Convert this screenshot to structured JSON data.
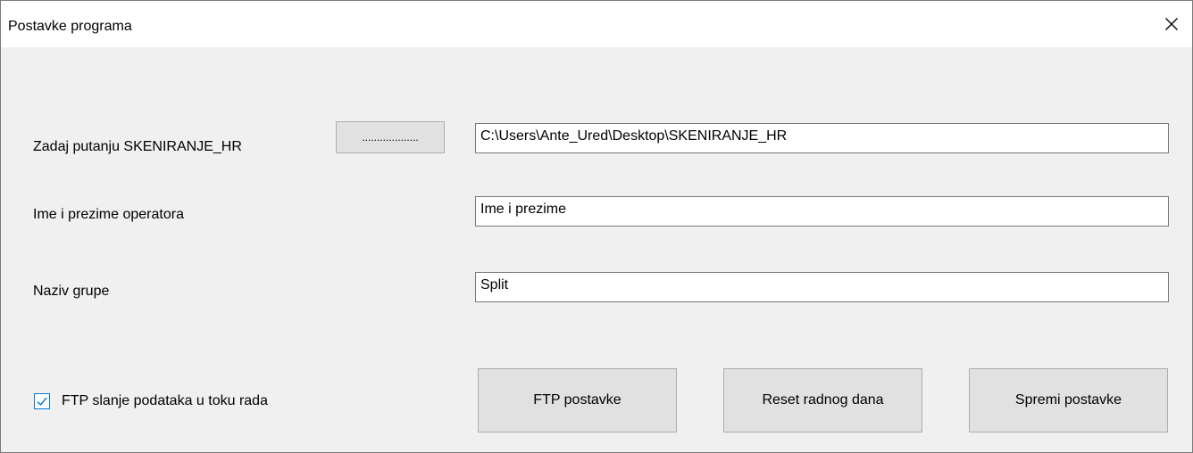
{
  "window": {
    "title": "Postavke programa"
  },
  "path": {
    "label": "Zadaj putanju  SKENIRANJE_HR",
    "browse_label": "...................",
    "value": "C:\\Users\\Ante_Ured\\Desktop\\SKENIRANJE_HR"
  },
  "operator": {
    "label": "Ime i prezime operatora",
    "value": "Ime i prezime"
  },
  "group": {
    "label": "Naziv grupe",
    "value": "Split"
  },
  "ftp_checkbox": {
    "label": "FTP slanje podataka u toku rada",
    "checked": true
  },
  "buttons": {
    "ftp_settings": "FTP postavke",
    "reset_day": "Reset radnog dana",
    "save_settings": "Spremi postavke"
  },
  "icons": {
    "close": "close-icon",
    "check": "checkmark-icon"
  },
  "colors": {
    "accent": "#0078d7",
    "button_face": "#e1e1e1",
    "window_bg": "#f0f0f0"
  }
}
